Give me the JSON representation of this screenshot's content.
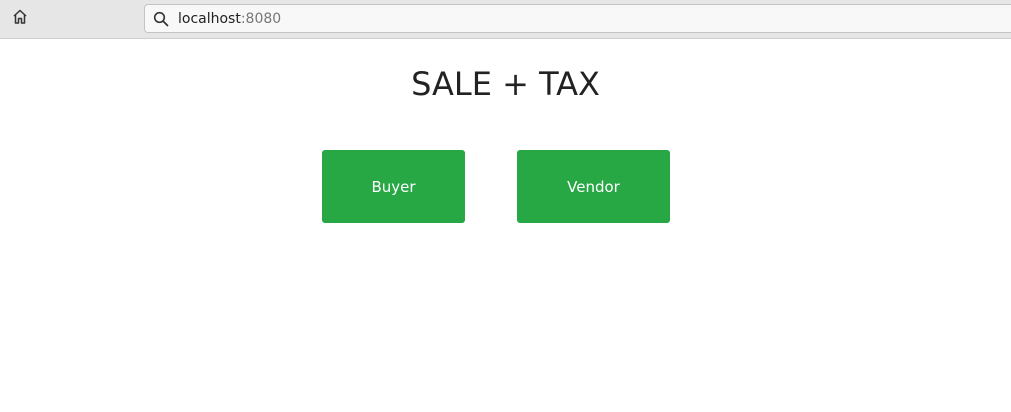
{
  "browser": {
    "home_icon": "home-icon",
    "search_icon": "search-icon",
    "url_host": "localhost",
    "url_port": ":8080"
  },
  "page": {
    "title": "SALE + TAX",
    "buttons": {
      "buyer_label": "Buyer",
      "vendor_label": "Vendor"
    }
  },
  "colors": {
    "button_bg": "#28a745",
    "button_text": "#ffffff",
    "title_text": "#222222",
    "toolbar_bg": "#e6e6e6"
  }
}
